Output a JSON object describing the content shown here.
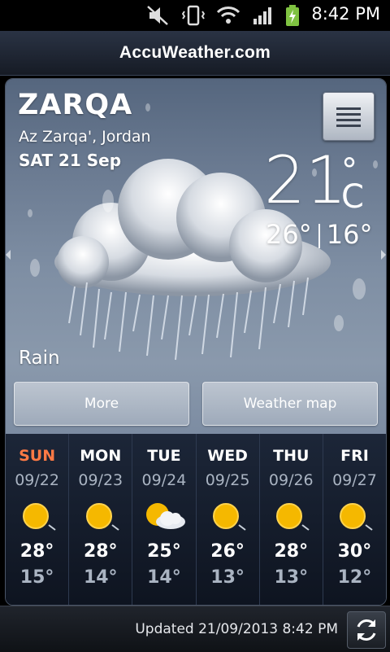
{
  "status_bar": {
    "time": "8:42 PM",
    "icons": [
      "mute-icon",
      "vibrate-icon",
      "wifi-icon",
      "signal-icon",
      "battery-charging-icon"
    ]
  },
  "app": {
    "brand": "AccuWeather.com"
  },
  "current": {
    "city": "ZARQA",
    "region": "Az Zarqa', Jordan",
    "date": "SAT 21 Sep",
    "temp": "21",
    "deg": "°",
    "unit": "C",
    "high": "26°",
    "low": "16°",
    "condition": "Rain",
    "condition_icon": "rain-cloud-icon"
  },
  "buttons": {
    "more": "More",
    "weather_map": "Weather map"
  },
  "forecast": [
    {
      "day": "SUN",
      "date": "09/22",
      "high": "28°",
      "low": "15°",
      "icon": "sunny-icon",
      "highlight": true
    },
    {
      "day": "MON",
      "date": "09/23",
      "high": "28°",
      "low": "14°",
      "icon": "sunny-icon"
    },
    {
      "day": "TUE",
      "date": "09/24",
      "high": "25°",
      "low": "14°",
      "icon": "partly-cloudy-icon"
    },
    {
      "day": "WED",
      "date": "09/25",
      "high": "26°",
      "low": "13°",
      "icon": "sunny-icon"
    },
    {
      "day": "THU",
      "date": "09/26",
      "high": "28°",
      "low": "13°",
      "icon": "sunny-icon"
    },
    {
      "day": "FRI",
      "date": "09/27",
      "high": "30°",
      "low": "12°",
      "icon": "sunny-icon"
    }
  ],
  "footer": {
    "updated": "Updated 21/09/2013 8:42 PM"
  },
  "colors": {
    "accent_day": "#ff7a45",
    "sun": "#f5b800"
  }
}
